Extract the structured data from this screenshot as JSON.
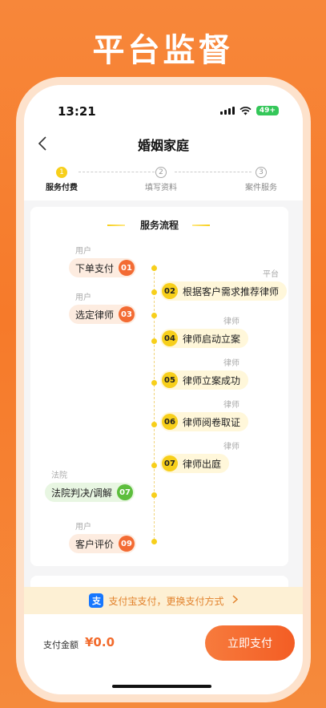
{
  "promo": {
    "title": "平台监督"
  },
  "status_bar": {
    "time": "13:21",
    "battery": "49+"
  },
  "nav": {
    "title": "婚姻家庭"
  },
  "stepper": {
    "steps": [
      {
        "num": "1",
        "label": "服务付费"
      },
      {
        "num": "2",
        "label": "填写资料"
      },
      {
        "num": "3",
        "label": "案件服务"
      }
    ]
  },
  "process": {
    "title": "服务流程",
    "items": [
      {
        "role": "用户",
        "text": "下单支付",
        "num": "01"
      },
      {
        "role": "平台",
        "text": "根据客户需求推荐律师",
        "num": "02"
      },
      {
        "role": "用户",
        "text": "选定律师",
        "num": "03"
      },
      {
        "role": "律师",
        "text": "律师启动立案",
        "num": "04"
      },
      {
        "role": "律师",
        "text": "律师立案成功",
        "num": "05"
      },
      {
        "role": "律师",
        "text": "律师阅卷取证",
        "num": "06"
      },
      {
        "role": "律师",
        "text": "律师出庭",
        "num": "07"
      },
      {
        "role": "法院",
        "text": "法院判决/调解",
        "num": "07"
      },
      {
        "role": "用户",
        "text": "客户评价",
        "num": "09"
      }
    ]
  },
  "payment_banner": {
    "icon": "支",
    "text": "支付宝支付，更换支付方式"
  },
  "footer": {
    "amount_label": "支付金额",
    "amount": "¥0.0",
    "pay_button": "立即支付"
  }
}
